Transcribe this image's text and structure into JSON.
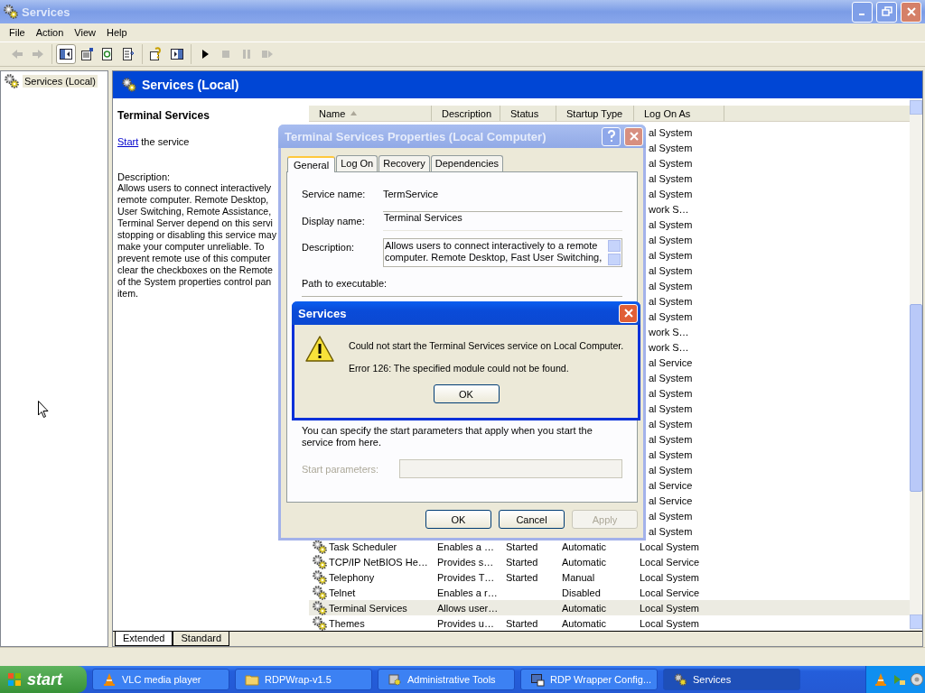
{
  "window": {
    "title": "Services"
  },
  "menu": [
    "File",
    "Action",
    "View",
    "Help"
  ],
  "toolbar": {
    "groups": [
      [
        {
          "disabled": true,
          "pressed": false
        },
        {
          "disabled": true,
          "pressed": false
        }
      ],
      [
        {
          "disabled": false,
          "pressed": true
        },
        {
          "disabled": false,
          "pressed": false
        },
        {
          "disabled": false,
          "pressed": false
        },
        {
          "disabled": false,
          "pressed": false
        }
      ],
      [
        {
          "disabled": false,
          "pressed": false
        },
        {
          "disabled": false,
          "pressed": false
        }
      ],
      [
        {
          "disabled": false,
          "pressed": false
        },
        {
          "disabled": true,
          "pressed": false
        },
        {
          "disabled": true,
          "pressed": false
        },
        {
          "disabled": true,
          "pressed": false
        }
      ]
    ]
  },
  "tree": [
    {
      "label": "Services (Local)",
      "selected": true
    }
  ],
  "pane_header": "Services (Local)",
  "details": {
    "title": "Terminal Services",
    "action_link": "Start",
    "action_rest": "the service",
    "description_label": "Description:",
    "description_lines": [
      "Allows users to connect interactively",
      "remote computer. Remote Desktop,",
      "User Switching, Remote Assistance,",
      "Terminal Server depend on this servi",
      "stopping or disabling this service may",
      "make your computer unreliable.  To",
      "prevent remote use of this computer",
      "clear the checkboxes on the Remote",
      "of the System properties control pan",
      "item."
    ]
  },
  "list": {
    "columns": [
      {
        "label": "Name",
        "sorted": true
      },
      {
        "label": "Description",
        "sorted": false
      },
      {
        "label": "Status",
        "sorted": false
      },
      {
        "label": "Startup Type",
        "sorted": false
      },
      {
        "label": "Log On As",
        "sorted": false
      }
    ],
    "rows": [
      {
        "kind": "covered",
        "log_on_as": "al System",
        "selected": false
      },
      {
        "kind": "covered",
        "log_on_as": "al System",
        "selected": false
      },
      {
        "kind": "covered",
        "log_on_as": "al System",
        "selected": false
      },
      {
        "kind": "covered",
        "log_on_as": "al System",
        "selected": false
      },
      {
        "kind": "covered",
        "log_on_as": "al System",
        "selected": false
      },
      {
        "kind": "covered",
        "log_on_as": "work S…",
        "selected": false
      },
      {
        "kind": "covered",
        "log_on_as": "al System",
        "selected": false
      },
      {
        "kind": "covered",
        "log_on_as": "al System",
        "selected": false
      },
      {
        "kind": "covered",
        "log_on_as": "al System",
        "selected": false
      },
      {
        "kind": "covered",
        "log_on_as": "al System",
        "selected": false
      },
      {
        "kind": "covered",
        "log_on_as": "al System",
        "selected": false
      },
      {
        "kind": "covered",
        "log_on_as": "al System",
        "selected": false
      },
      {
        "kind": "covered",
        "log_on_as": "al System",
        "selected": false
      },
      {
        "kind": "covered",
        "log_on_as": "work S…",
        "selected": false
      },
      {
        "kind": "covered",
        "log_on_as": "work S…",
        "selected": false
      },
      {
        "kind": "covered",
        "log_on_as": "al Service",
        "selected": false
      },
      {
        "kind": "covered",
        "log_on_as": "al System",
        "selected": false
      },
      {
        "kind": "covered",
        "log_on_as": "al System",
        "selected": false
      },
      {
        "kind": "covered",
        "log_on_as": "al System",
        "selected": false
      },
      {
        "kind": "covered",
        "log_on_as": "al System",
        "selected": false
      },
      {
        "kind": "covered",
        "log_on_as": "al System",
        "selected": false
      },
      {
        "kind": "covered",
        "log_on_as": "al System",
        "selected": false
      },
      {
        "kind": "covered",
        "log_on_as": "al System",
        "selected": false
      },
      {
        "kind": "covered",
        "log_on_as": "al Service",
        "selected": false
      },
      {
        "kind": "covered",
        "log_on_as": "al Service",
        "selected": false
      },
      {
        "kind": "covered",
        "log_on_as": "al System",
        "selected": false
      },
      {
        "kind": "covered",
        "log_on_as": "al System",
        "selected": false
      },
      {
        "kind": "service",
        "name": "Task Scheduler",
        "description": "Enables a …",
        "status": "Started",
        "startup_type": "Automatic",
        "log_on_as": "Local System",
        "selected": false
      },
      {
        "kind": "service",
        "name": "TCP/IP NetBIOS He…",
        "description": "Provides s…",
        "status": "Started",
        "startup_type": "Automatic",
        "log_on_as": "Local Service",
        "selected": false
      },
      {
        "kind": "service",
        "name": "Telephony",
        "description": "Provides T…",
        "status": "Started",
        "startup_type": "Manual",
        "log_on_as": "Local System",
        "selected": false
      },
      {
        "kind": "service",
        "name": "Telnet",
        "description": "Enables a r…",
        "status": "",
        "startup_type": "Disabled",
        "log_on_as": "Local Service",
        "selected": false
      },
      {
        "kind": "service",
        "name": "Terminal Services",
        "description": "Allows user…",
        "status": "",
        "startup_type": "Automatic",
        "log_on_as": "Local System",
        "selected": true
      },
      {
        "kind": "service",
        "name": "Themes",
        "description": "Provides u…",
        "status": "Started",
        "startup_type": "Automatic",
        "log_on_as": "Local System",
        "selected": false
      }
    ]
  },
  "view_tabs": [
    {
      "label": "Extended",
      "selected": true
    },
    {
      "label": "Standard",
      "selected": false
    }
  ],
  "properties_dialog": {
    "title": "Terminal Services Properties (Local Computer)",
    "tabs": [
      {
        "label": "General",
        "selected": true
      },
      {
        "label": "Log On",
        "selected": false
      },
      {
        "label": "Recovery",
        "selected": false
      },
      {
        "label": "Dependencies",
        "selected": false
      }
    ],
    "service_name_label": "Service name:",
    "service_name": "TermService",
    "display_name_label": "Display name:",
    "display_name": "Terminal Services",
    "description_label": "Description:",
    "description_lines": [
      "Allows users to connect interactively to a remote",
      "computer. Remote Desktop, Fast User Switching,"
    ],
    "path_label": "Path to executable:",
    "start_hint": "You can specify the start parameters that apply when you start the service from here.",
    "start_params_label": "Start parameters:",
    "start_params_disabled": true,
    "buttons": [
      {
        "label": "OK",
        "disabled": false
      },
      {
        "label": "Cancel",
        "disabled": false
      },
      {
        "label": "Apply",
        "disabled": true
      }
    ]
  },
  "error_dialog": {
    "title": "Services",
    "messages": [
      "Could not start the Terminal Services service on Local Computer.",
      "Error 126: The specified module could not be found."
    ],
    "button": "OK"
  },
  "taskbar": {
    "start": "start",
    "tasks": [
      {
        "label": "VLC media player",
        "selected": false
      },
      {
        "label": "RDPWrap-v1.5",
        "selected": false
      },
      {
        "label": "Administrative Tools",
        "selected": false
      },
      {
        "label": "RDP Wrapper Config...",
        "selected": false
      },
      {
        "label": "Services",
        "selected": true
      }
    ]
  }
}
